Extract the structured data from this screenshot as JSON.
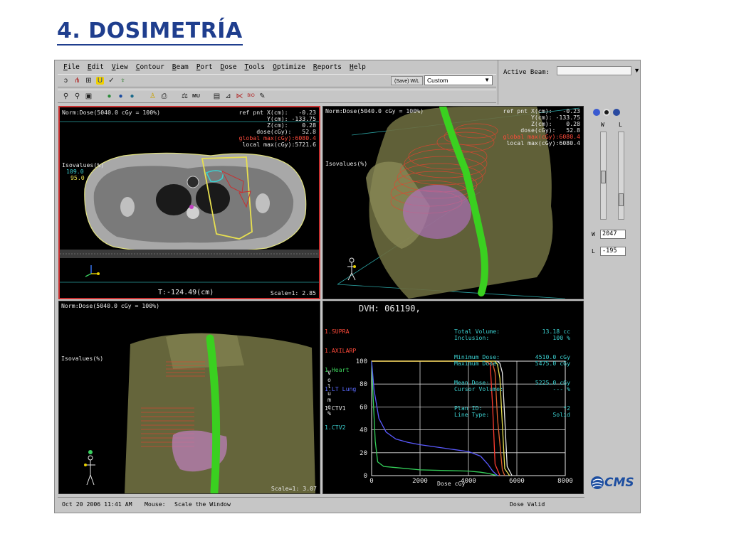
{
  "slide": {
    "title": "4. DOSIMETRÍA"
  },
  "menu": [
    "File",
    "Edit",
    "View",
    "Contour",
    "Beam",
    "Port",
    "Dose",
    "Tools",
    "Optimize",
    "Reports",
    "Help"
  ],
  "toolbar": {
    "wl_button": "(Save) W/L",
    "wl_select": "Custom"
  },
  "active_beam": {
    "label": "Active Beam:",
    "value": ""
  },
  "viewports": {
    "axial": {
      "norm": "Norm:Dose(5040.0 cGy = 100%)",
      "ref_lines": [
        "ref pnt X(cm):   -0.23",
        "Y(cm): -133.75",
        "Z(cm):    0.28",
        "dose(cGy):   52.8"
      ],
      "global_max": "global max(cGy):6080.4",
      "local_max": "local max(cGy):5721.6",
      "isovalues_label": "Isovalues(%)",
      "iso_1": "109.0",
      "iso_2": "95.0",
      "slice": "T:-124.49(cm)",
      "scale": "Scale=1: 2.85"
    },
    "beams_eye": {
      "norm": "Norm:Dose(5040.0 cGy = 100%)",
      "ref_lines": [
        "ref pnt X(cm):   -0.23",
        "Y(cm): -133.75",
        "Z(cm):    0.28",
        "dose(cGy):   52.8"
      ],
      "global_max": "global max(cGy):6080.4",
      "local_max": "local max(cGy):6080.4",
      "isovalues_label": "Isovalues(%)"
    },
    "coronal": {
      "norm": "Norm:Dose(5040.0 cGy = 100%)",
      "isovalues_label": "Isovalues(%)",
      "scale": "Scale=1: 3.07"
    },
    "dvh": {
      "title": "DVH: 061190,",
      "structures": [
        {
          "name": "1.SUPRA",
          "color": "#ff4a3a"
        },
        {
          "name": "1.AXILARP",
          "color": "#ff4a3a"
        },
        {
          "name": "1.Heart",
          "color": "#3bd05a"
        },
        {
          "name": "1.LT Lung",
          "color": "#5a6aff"
        },
        {
          "name": "1.CTV1",
          "color": "#e8e8e8"
        },
        {
          "name": "1.CTV2",
          "color": "#3bd0d0"
        }
      ],
      "stats_labels": [
        "Total Volume:",
        "Inclusion:",
        "Minimum Dose:",
        "Maximum Dose:",
        "Mean Dose:",
        "Cursor Volume:",
        "Plan ID:",
        "Line Type:"
      ],
      "stats_values": [
        "13.18 cc",
        "100 %",
        "4510.0 cGy",
        "5475.0 cGy",
        "5225.0 cGy",
        "--- %",
        "*2",
        "Solid"
      ],
      "ylabel": "Volume %",
      "xlabel": "Dose cGy"
    }
  },
  "chart_data": {
    "type": "line",
    "title": "DVH: 061190,",
    "xlabel": "Dose cGy",
    "ylabel": "Volume %",
    "xlim": [
      0,
      8000
    ],
    "ylim": [
      0,
      100
    ],
    "x_ticks": [
      0,
      2000,
      4000,
      6000,
      8000
    ],
    "y_ticks": [
      0,
      20,
      40,
      60,
      80,
      100
    ],
    "grid": true,
    "series": [
      {
        "name": "1.SUPRA",
        "color": "#ff3b30",
        "x": [
          0,
          4700,
          4800,
          4900,
          5000,
          5100,
          5300
        ],
        "y": [
          100,
          100,
          99,
          97,
          60,
          10,
          0
        ]
      },
      {
        "name": "1.AXILARP",
        "color": "#e06030",
        "x": [
          0,
          4900,
          5000,
          5100,
          5200,
          5400,
          5500
        ],
        "y": [
          100,
          100,
          98,
          90,
          50,
          5,
          0
        ]
      },
      {
        "name": "1.Heart",
        "color": "#34d05a",
        "x": [
          0,
          60,
          150,
          250,
          500,
          1000,
          2000,
          3000,
          4000,
          4500,
          4800,
          5000,
          5200
        ],
        "y": [
          100,
          70,
          30,
          12,
          8,
          7,
          5,
          4.5,
          4,
          3,
          2,
          1,
          0
        ]
      },
      {
        "name": "1.LT Lung",
        "color": "#5a5aff",
        "x": [
          0,
          100,
          300,
          600,
          1000,
          1500,
          2000,
          3000,
          4000,
          4500,
          4800,
          5000,
          5200
        ],
        "y": [
          100,
          75,
          50,
          38,
          32,
          29,
          27,
          24,
          21,
          17,
          10,
          4,
          0
        ]
      },
      {
        "name": "1.CTV1",
        "color": "#e8e8e8",
        "x": [
          0,
          5200,
          5300,
          5400,
          5500,
          5600,
          5800
        ],
        "y": [
          100,
          100,
          98,
          90,
          50,
          8,
          0
        ]
      },
      {
        "name": "1.CTV2",
        "color": "#e8e050",
        "x": [
          0,
          5100,
          5200,
          5300,
          5400,
          5500,
          5700
        ],
        "y": [
          100,
          100,
          97,
          85,
          45,
          6,
          0
        ]
      }
    ]
  },
  "side_panel": {
    "w_label": "W",
    "l_label": "L",
    "w_value": "2047",
    "l_value": "-195"
  },
  "logo": {
    "text": "CMS"
  },
  "status": {
    "date": "Oct 20 2006 11:41 AM",
    "mouse_label": "Mouse:",
    "mouse_value": "Scale the Window",
    "dose_status": "Dose Valid"
  }
}
